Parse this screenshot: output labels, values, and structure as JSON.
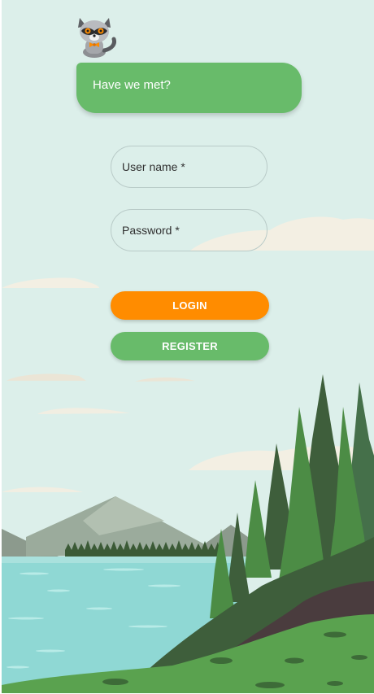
{
  "greeting": {
    "text": "Have we met?"
  },
  "form": {
    "username_label": "User name *",
    "password_label": "Password *"
  },
  "buttons": {
    "login_label": "LOGIN",
    "register_label": "REGISTER"
  },
  "colors": {
    "background": "#dcefea",
    "greeting_bubble": "#68bb6a",
    "login_button": "#ff8c00",
    "register_button": "#68bb6a",
    "lake": "#8fd8d4",
    "forest_dark": "#3d5a3b",
    "forest": "#4c8c45",
    "ground_brown": "#4a3c3e"
  },
  "icons": {
    "mascot": "raccoon-mascot-icon"
  }
}
